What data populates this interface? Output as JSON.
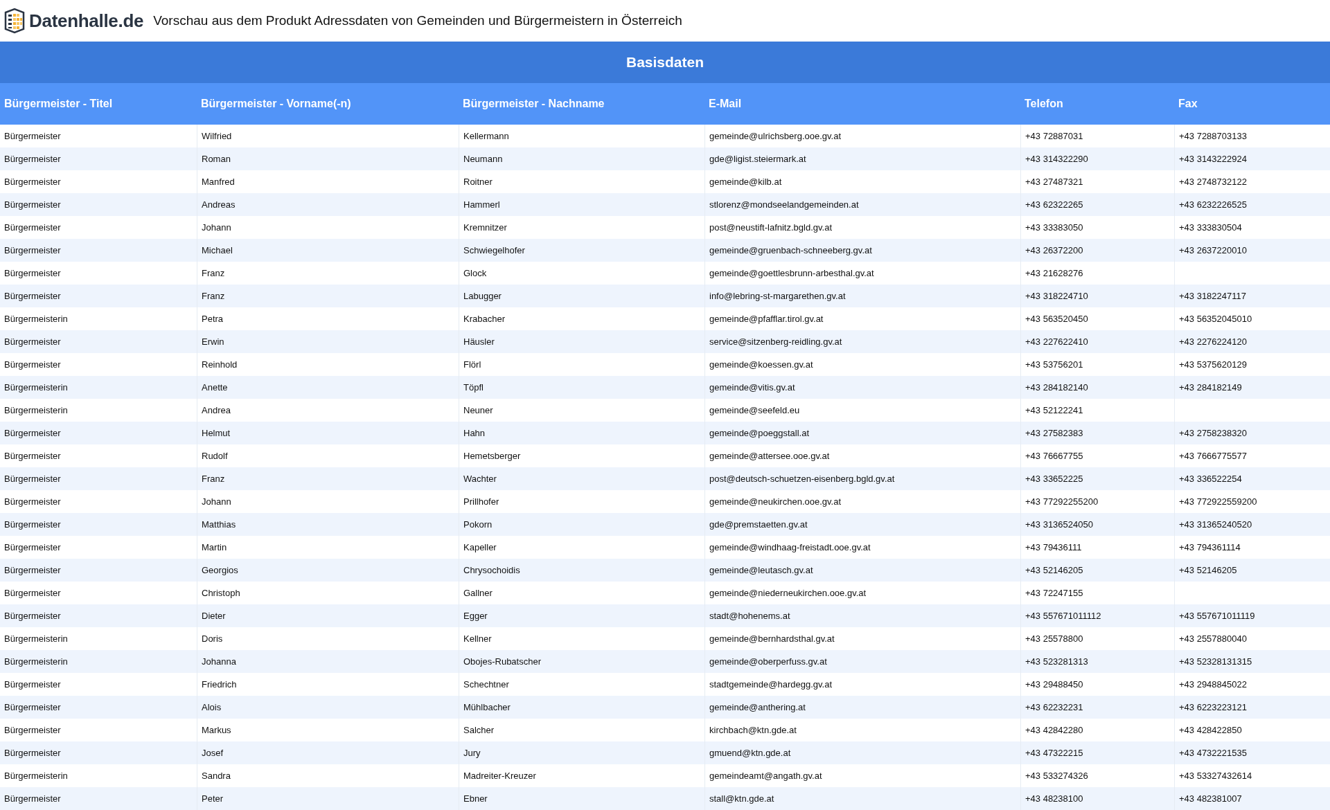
{
  "header": {
    "logo_text": "Datenhalle.de",
    "title": "Vorschau aus dem Produkt Adressdaten von Gemeinden und Bürgermeistern in Österreich"
  },
  "table": {
    "group_title": "Basisdaten",
    "columns": [
      "Bürgermeister - Titel",
      "Bürgermeister - Vorname(-n)",
      "Bürgermeister - Nachname",
      "E-Mail",
      "Telefon",
      "Fax"
    ],
    "rows": [
      {
        "titel": "Bürgermeister",
        "vorname": "Wilfried",
        "nachname": "Kellermann",
        "email": "gemeinde@ulrichsberg.ooe.gv.at",
        "telefon": "+43 72887031",
        "fax": "+43 7288703133"
      },
      {
        "titel": "Bürgermeister",
        "vorname": "Roman",
        "nachname": "Neumann",
        "email": "gde@ligist.steiermark.at",
        "telefon": "+43 314322290",
        "fax": "+43 3143222924"
      },
      {
        "titel": "Bürgermeister",
        "vorname": "Manfred",
        "nachname": "Roitner",
        "email": "gemeinde@kilb.at",
        "telefon": "+43 27487321",
        "fax": "+43 2748732122"
      },
      {
        "titel": "Bürgermeister",
        "vorname": "Andreas",
        "nachname": "Hammerl",
        "email": "stlorenz@mondseelandgemeinden.at",
        "telefon": "+43 62322265",
        "fax": "+43 6232226525"
      },
      {
        "titel": "Bürgermeister",
        "vorname": "Johann",
        "nachname": "Kremnitzer",
        "email": "post@neustift-lafnitz.bgld.gv.at",
        "telefon": "+43 33383050",
        "fax": "+43 333830504"
      },
      {
        "titel": "Bürgermeister",
        "vorname": "Michael",
        "nachname": "Schwiegelhofer",
        "email": "gemeinde@gruenbach-schneeberg.gv.at",
        "telefon": "+43 26372200",
        "fax": "+43 2637220010"
      },
      {
        "titel": "Bürgermeister",
        "vorname": "Franz",
        "nachname": "Glock",
        "email": "gemeinde@goettlesbrunn-arbesthal.gv.at",
        "telefon": "+43 21628276"
      },
      {
        "titel": "Bürgermeister",
        "vorname": "Franz",
        "nachname": "Labugger",
        "email": "info@lebring-st-margarethen.gv.at",
        "telefon": "+43 318224710",
        "fax": "+43 3182247117"
      },
      {
        "titel": "Bürgermeisterin",
        "vorname": "Petra",
        "nachname": "Krabacher",
        "email": "gemeinde@pfafflar.tirol.gv.at",
        "telefon": "+43 563520450",
        "fax": "+43 56352045010"
      },
      {
        "titel": "Bürgermeister",
        "vorname": "Erwin",
        "nachname": "Häusler",
        "email": "service@sitzenberg-reidling.gv.at",
        "telefon": "+43 227622410",
        "fax": "+43 2276224120"
      },
      {
        "titel": "Bürgermeister",
        "vorname": "Reinhold",
        "nachname": "Flörl",
        "email": "gemeinde@koessen.gv.at",
        "telefon": "+43 53756201",
        "fax": "+43 5375620129"
      },
      {
        "titel": "Bürgermeisterin",
        "vorname": "Anette",
        "nachname": "Töpfl",
        "email": "gemeinde@vitis.gv.at",
        "telefon": "+43 284182140",
        "fax": "+43 284182149"
      },
      {
        "titel": "Bürgermeisterin",
        "vorname": "Andrea",
        "nachname": "Neuner",
        "email": "gemeinde@seefeld.eu",
        "telefon": "+43 52122241"
      },
      {
        "titel": "Bürgermeister",
        "vorname": "Helmut",
        "nachname": "Hahn",
        "email": "gemeinde@poeggstall.at",
        "telefon": "+43 27582383",
        "fax": "+43 2758238320"
      },
      {
        "titel": "Bürgermeister",
        "vorname": "Rudolf",
        "nachname": "Hemetsberger",
        "email": "gemeinde@attersee.ooe.gv.at",
        "telefon": "+43 76667755",
        "fax": "+43 7666775577"
      },
      {
        "titel": "Bürgermeister",
        "vorname": "Franz",
        "nachname": "Wachter",
        "email": "post@deutsch-schuetzen-eisenberg.bgld.gv.at",
        "telefon": "+43 33652225",
        "fax": "+43 336522254"
      },
      {
        "titel": "Bürgermeister",
        "vorname": "Johann",
        "nachname": "Prillhofer",
        "email": "gemeinde@neukirchen.ooe.gv.at",
        "telefon": "+43 77292255200",
        "fax": "+43 772922559200"
      },
      {
        "titel": "Bürgermeister",
        "vorname": "Matthias",
        "nachname": "Pokorn",
        "email": "gde@premstaetten.gv.at",
        "telefon": "+43 3136524050",
        "fax": "+43 31365240520"
      },
      {
        "titel": "Bürgermeister",
        "vorname": "Martin",
        "nachname": "Kapeller",
        "email": "gemeinde@windhaag-freistadt.ooe.gv.at",
        "telefon": "+43 79436111",
        "fax": "+43 794361114"
      },
      {
        "titel": "Bürgermeister",
        "vorname": "Georgios",
        "nachname": "Chrysochoidis",
        "email": "gemeinde@leutasch.gv.at",
        "telefon": "+43 52146205",
        "fax": "+43 52146205"
      },
      {
        "titel": "Bürgermeister",
        "vorname": "Christoph",
        "nachname": "Gallner",
        "email": "gemeinde@niederneukirchen.ooe.gv.at",
        "telefon": "+43 72247155"
      },
      {
        "titel": "Bürgermeister",
        "vorname": "Dieter",
        "nachname": "Egger",
        "email": "stadt@hohenems.at",
        "telefon": "+43 557671011112",
        "fax": "+43 557671011119"
      },
      {
        "titel": "Bürgermeisterin",
        "vorname": "Doris",
        "nachname": "Kellner",
        "email": "gemeinde@bernhardsthal.gv.at",
        "telefon": "+43 25578800",
        "fax": "+43 2557880040"
      },
      {
        "titel": "Bürgermeisterin",
        "vorname": "Johanna",
        "nachname": "Obojes-Rubatscher",
        "email": "gemeinde@oberperfuss.gv.at",
        "telefon": "+43 523281313",
        "fax": "+43 52328131315"
      },
      {
        "titel": "Bürgermeister",
        "vorname": "Friedrich",
        "nachname": "Schechtner",
        "email": "stadtgemeinde@hardegg.gv.at",
        "telefon": "+43 29488450",
        "fax": "+43 2948845022"
      },
      {
        "titel": "Bürgermeister",
        "vorname": "Alois",
        "nachname": "Mühlbacher",
        "email": "gemeinde@anthering.at",
        "telefon": "+43 62232231",
        "fax": "+43 6223223121"
      },
      {
        "titel": "Bürgermeister",
        "vorname": "Markus",
        "nachname": "Salcher",
        "email": "kirchbach@ktn.gde.at",
        "telefon": "+43 42842280",
        "fax": "+43 428422850"
      },
      {
        "titel": "Bürgermeister",
        "vorname": "Josef",
        "nachname": "Jury",
        "email": "gmuend@ktn.gde.at",
        "telefon": "+43 47322215",
        "fax": "+43 4732221535"
      },
      {
        "titel": "Bürgermeisterin",
        "vorname": "Sandra",
        "nachname": "Madreiter-Kreuzer",
        "email": "gemeindeamt@angath.gv.at",
        "telefon": "+43 533274326",
        "fax": "+43 53327432614"
      },
      {
        "titel": "Bürgermeister",
        "vorname": "Peter",
        "nachname": "Ebner",
        "email": "stall@ktn.gde.at",
        "telefon": "+43 48238100",
        "fax": "+43 482381007"
      }
    ]
  }
}
